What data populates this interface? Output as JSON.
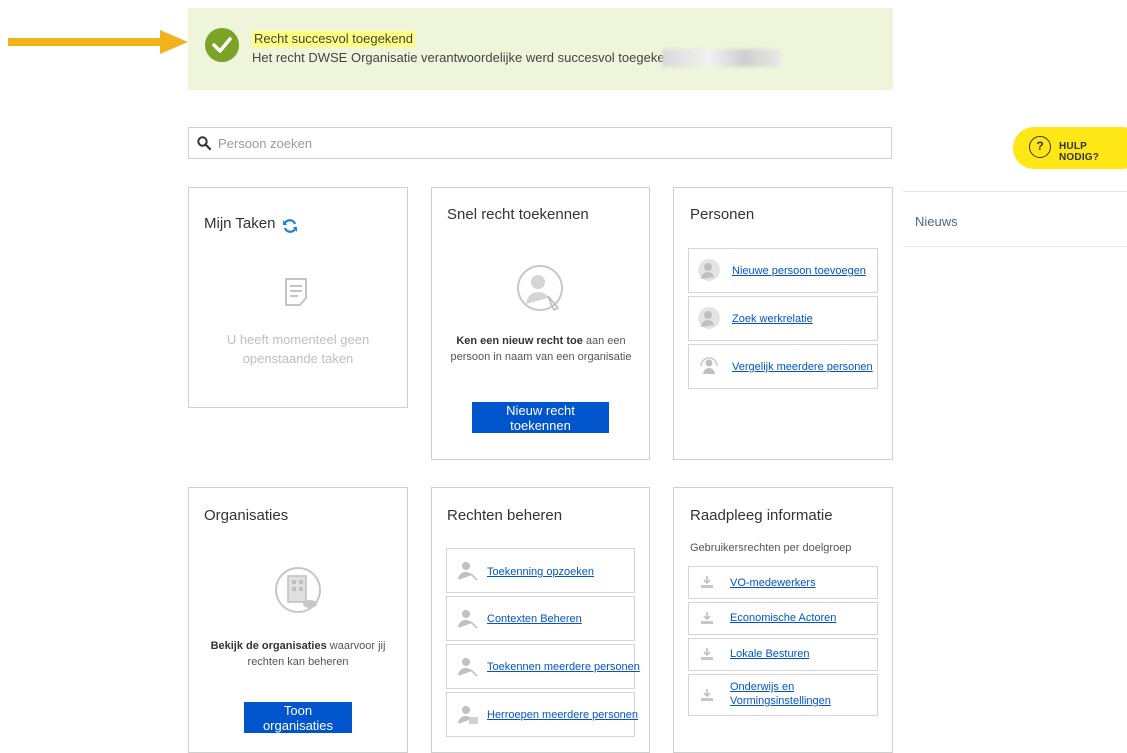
{
  "banner": {
    "title": "Recht succesvol toegekend",
    "message": "Het recht DWSE Organisatie verantwoordelijke werd succesvol toegekend aan"
  },
  "search": {
    "placeholder": "Persoon zoeken"
  },
  "help": {
    "label": "HULP NODIG?"
  },
  "news": {
    "label": "Nieuws"
  },
  "cards": {
    "mijn_taken": {
      "title": "Mijn Taken",
      "empty_line1": "U heeft momenteel geen",
      "empty_line2": "openstaande taken"
    },
    "snel_recht": {
      "title": "Snel recht toekennen",
      "desc_bold": "Ken een nieuw recht toe",
      "desc_rest1": " aan een",
      "desc_line2": "persoon in naam van een organisatie",
      "button": "Nieuw recht toekennen"
    },
    "personen": {
      "title": "Personen",
      "links": [
        "Nieuwe persoon toevoegen",
        "Zoek werkrelatie",
        "Vergelijk meerdere personen"
      ]
    },
    "organisaties": {
      "title": "Organisaties",
      "desc_bold": "Bekijk de organisaties",
      "desc_rest1": " waarvoor jij",
      "desc_line2": "rechten kan beheren",
      "button": "Toon organisaties"
    },
    "rechten_beheren": {
      "title": "Rechten beheren",
      "links": [
        "Toekenning opzoeken",
        "Contexten Beheren",
        "Toekennen meerdere personen",
        "Herroepen meerdere personen"
      ]
    },
    "raadpleeg": {
      "title": "Raadpleeg informatie",
      "subtitle": "Gebruikersrechten per doelgroep",
      "links": [
        "VO-medewerkers",
        "Economische Actoren",
        "Lokale Besturen",
        "Onderwijs en",
        "Vormingsinstellingen"
      ]
    }
  },
  "colors": {
    "accent_blue": "#0055cc",
    "success_green": "#7aa327",
    "banner_bg": "#eef5da",
    "help_yellow": "#ffe615",
    "arrow_orange": "#f2b21c"
  }
}
